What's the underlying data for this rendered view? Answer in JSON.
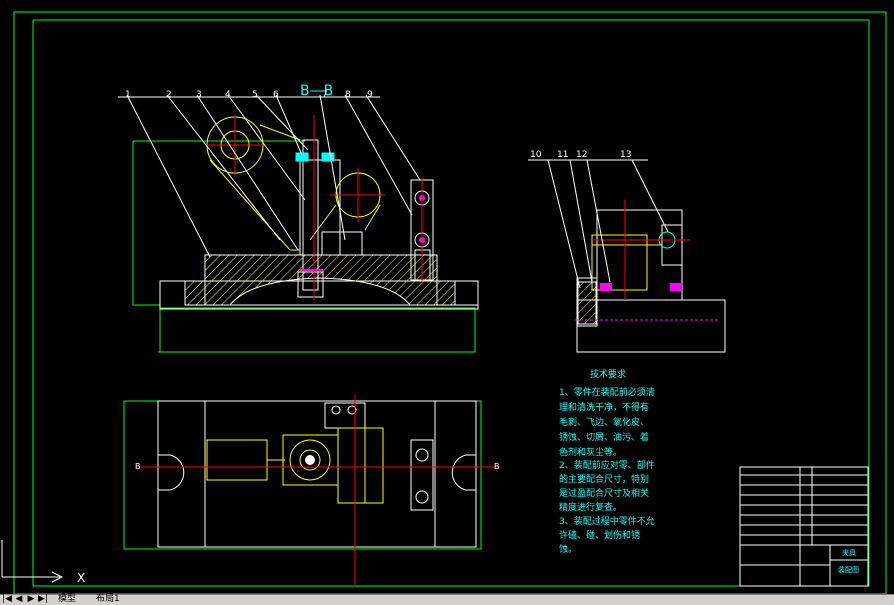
{
  "colors": {
    "background": "#000000",
    "frame": "#00ff00",
    "part": "#ffffff",
    "fixture": "#ffff00",
    "center": "#ff0000",
    "hatch": "#ffff00",
    "fastener": "#ff00ff",
    "note": "#00ffff",
    "table": "#ffffff"
  },
  "section_title": "B—B",
  "balloons": [
    "1",
    "2",
    "3",
    "4",
    "5",
    "6",
    "7",
    "8",
    "9",
    "10",
    "11",
    "12",
    "13"
  ],
  "section_marks": {
    "left": "B",
    "right": "B"
  },
  "axis_x_label": "X",
  "tech_req": {
    "title": "技术要求",
    "lines": [
      "1、零件在装配前必须清",
      "理和清洗干净，不得有",
      "毛刺、飞边、氧化皮、",
      "锈蚀、切屑、油污、着",
      "色剂和灰尘等。",
      "2、装配前应对零、部件",
      "的主要配合尺寸，特别",
      "是过盈配合尺寸及相关",
      "精度进行复查。",
      "3、装配过程中零件不允",
      "许磕、碰、划伤和锈",
      "蚀。"
    ]
  },
  "title_block": {
    "name_cell": "夹具",
    "sub_cell": "装配图"
  },
  "tabs": [
    "模型",
    "布局1"
  ]
}
